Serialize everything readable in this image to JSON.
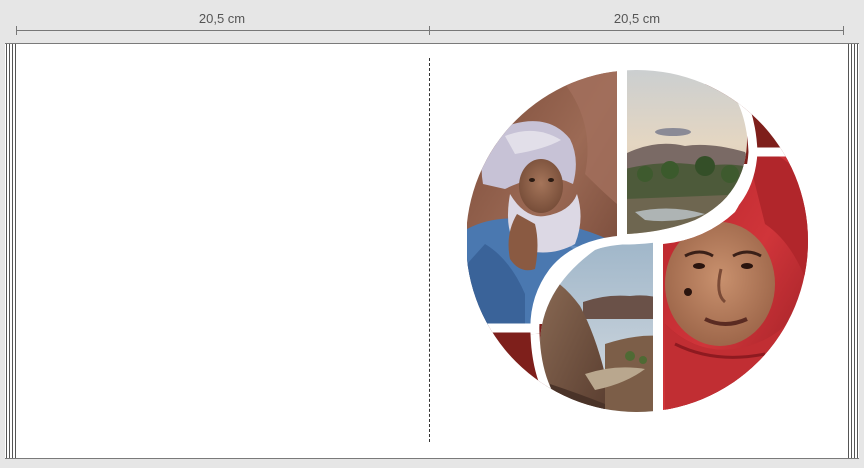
{
  "ruler": {
    "left_label": "20,5 cm",
    "right_label": "20,5 cm"
  },
  "layout": {
    "pages": [
      "left-page",
      "right-page"
    ],
    "collage_shape": "yin-yang-circle",
    "photos": [
      "man-with-white-turban-photo",
      "valley-with-palms-photo",
      "canyon-river-photo",
      "man-with-red-turban-photo"
    ]
  },
  "colors": {
    "background": "#e6e6e6",
    "page": "#ffffff",
    "accent": "#7e1f1b",
    "ruler_text": "#555555"
  }
}
